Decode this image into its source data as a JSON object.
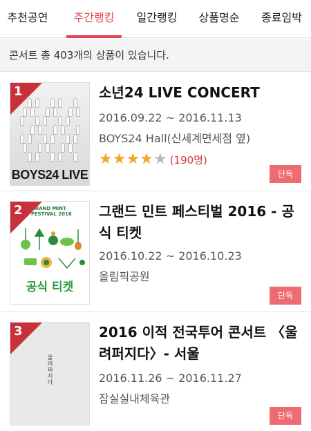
{
  "tabs": [
    {
      "label": "추천공연",
      "active": false
    },
    {
      "label": "주간랭킹",
      "active": true
    },
    {
      "label": "일간랭킹",
      "active": false
    },
    {
      "label": "상품명순",
      "active": false
    },
    {
      "label": "종료임박",
      "active": false
    }
  ],
  "summary": "콘서트 총 403개의 상품이 있습니다.",
  "colors": {
    "accent": "#e24854",
    "badge": "#ef6b72",
    "rank_flag": "#c8313b",
    "star": "#f5a623"
  },
  "items": [
    {
      "rank": "1",
      "title": "소년24 LIVE CONCERT",
      "date": "2016.09.22 ~ 2016.11.13",
      "venue": "BOYS24 Hall(신세계면세점 옆)",
      "rating_stars": 4,
      "rating_max": 5,
      "reviews": "(190명)",
      "badge": "단독",
      "poster_text": "BOYS24 LIVE"
    },
    {
      "rank": "2",
      "title": "그랜드 민트 페스티벌 2016 - 공식 티켓",
      "date": "2016.10.22 ~ 2016.10.23",
      "venue": "올림픽공원",
      "badge": "단독",
      "poster_head": "GRAND MINT FESTIVAL 2016",
      "poster_text": "공식 티켓"
    },
    {
      "rank": "3",
      "title": "2016 이적 전국투어 콘서트 〈울려퍼지다〉- 서울",
      "date": "2016.11.26 ~ 2016.11.27",
      "venue": "잠실실내체육관",
      "badge": "단독",
      "poster_text": "울려퍼지다"
    }
  ]
}
